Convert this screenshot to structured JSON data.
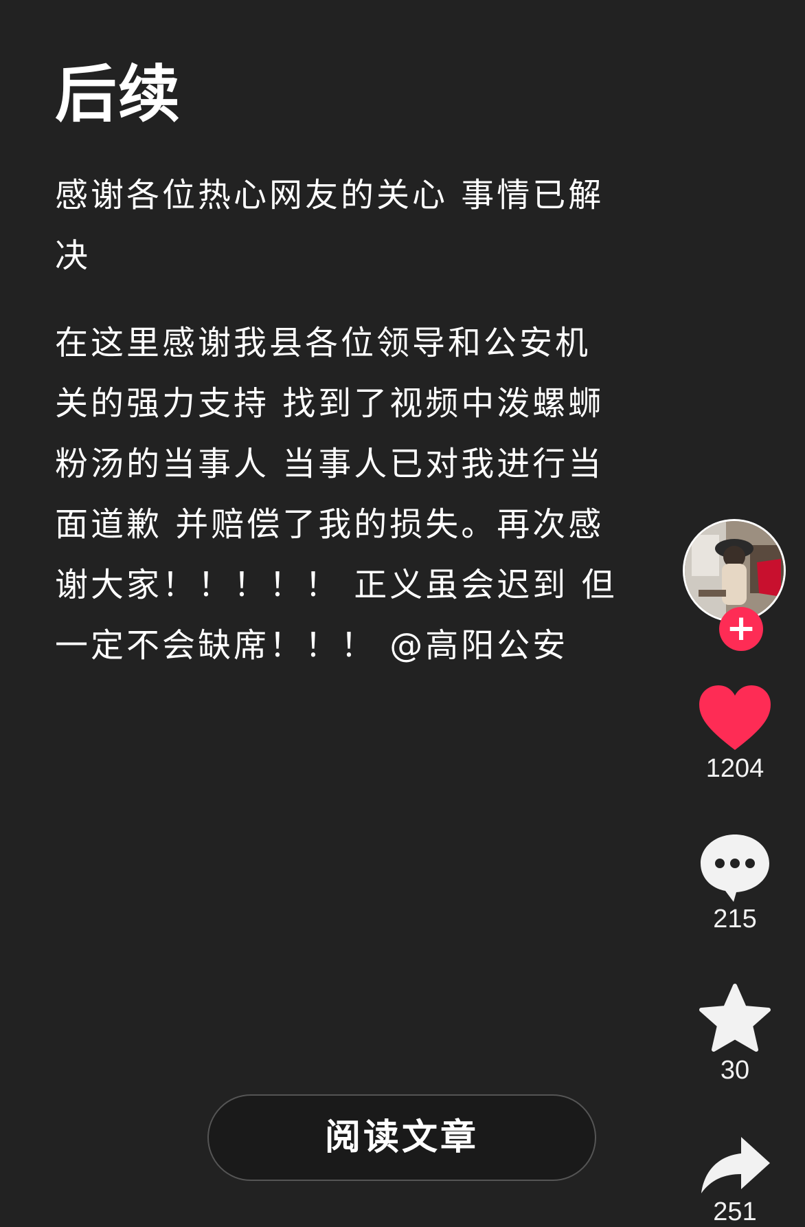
{
  "post": {
    "title": "后续",
    "paragraph1": "感谢各位热心网友的关心  事情已解决",
    "paragraph2": "在这里感谢我县各位领导和公安机关的强力支持 找到了视频中泼螺蛳粉汤的当事人 当事人已对我进行当面道歉 并赔偿了我的损失。再次感谢大家！！！！！ 正义虽会迟到 但一定不会缺席！！！ @高阳公安"
  },
  "sidebar": {
    "follow_symbol": "+",
    "likes": "1204",
    "comments": "215",
    "favorites": "30",
    "shares": "251",
    "like_color": "#fe2c55"
  },
  "footer": {
    "read_article_label": "阅读文章"
  }
}
